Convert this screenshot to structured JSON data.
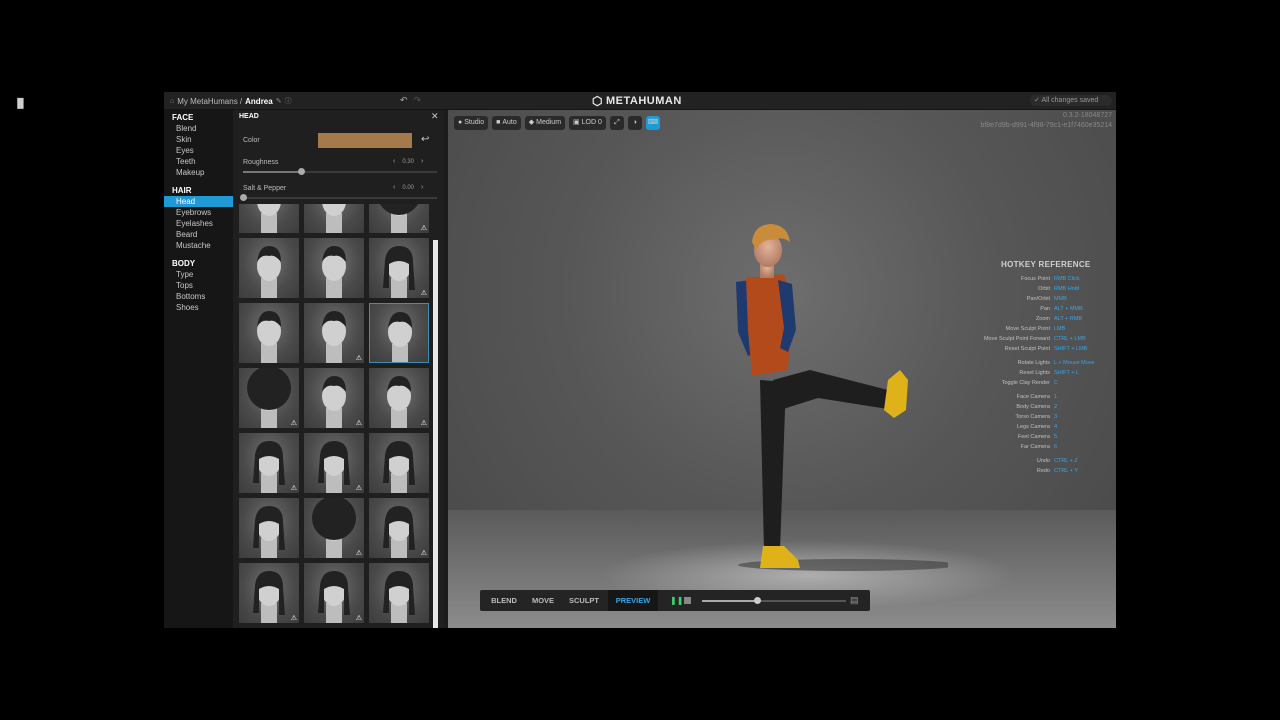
{
  "topbar": {
    "breadcrumb_root": "My MetaHumans /",
    "character_name": "Andrea",
    "logo": "METAHUMAN",
    "save_status": "All changes saved"
  },
  "sidebar": {
    "sections": [
      {
        "title": "FACE",
        "items": [
          "Blend",
          "Skin",
          "Eyes",
          "Teeth",
          "Makeup"
        ]
      },
      {
        "title": "HAIR",
        "items": [
          "Head",
          "Eyebrows",
          "Eyelashes",
          "Beard",
          "Mustache"
        ]
      },
      {
        "title": "BODY",
        "items": [
          "Type",
          "Tops",
          "Bottoms",
          "Shoes"
        ]
      }
    ],
    "active_item": "Head"
  },
  "panel": {
    "title": "HEAD",
    "color_label": "Color",
    "color_value": "#a47a4c",
    "roughness_label": "Roughness",
    "roughness_value": "0.30",
    "roughness_level": 0.3,
    "salt_pepper_label": "Salt & Pepper",
    "salt_pepper_value": "0.00",
    "salt_pepper_level": 0.0,
    "hairstyles": [
      {
        "warn": false
      },
      {
        "warn": false
      },
      {
        "warn": true
      },
      {
        "warn": false
      },
      {
        "warn": false
      },
      {
        "warn": true
      },
      {
        "warn": false
      },
      {
        "warn": true
      },
      {
        "warn": false,
        "selected": true
      },
      {
        "warn": true
      },
      {
        "warn": true
      },
      {
        "warn": true
      },
      {
        "warn": true
      },
      {
        "warn": true
      },
      {
        "warn": false
      },
      {
        "warn": false
      },
      {
        "warn": true
      },
      {
        "warn": true
      },
      {
        "warn": true
      },
      {
        "warn": true
      },
      {
        "warn": false
      }
    ]
  },
  "viewport": {
    "toolbar": {
      "lighting": "Studio",
      "camera": "Auto",
      "quality": "Medium",
      "lod": "LOD 0"
    },
    "version_line1": "0.3.2-18048727",
    "version_line2": "bf8e7d9b-d991-4f98-79c1-e1f7460e35214",
    "hotkeys_title": "HOTKEY REFERENCE",
    "hotkeys": [
      {
        "action": "Focus Point",
        "key": "RMB Click"
      },
      {
        "action": "Orbit",
        "key": "RMB Hold"
      },
      {
        "action": "Pan/Orbit",
        "key": "MMB"
      },
      {
        "action": "Pan",
        "key": "ALT + MMB"
      },
      {
        "action": "Zoom",
        "key": "ALT + RMB"
      },
      {
        "action": "Move Sculpt Point",
        "key": "LMB"
      },
      {
        "action": "Move Sculpt Point Forward",
        "key": "CTRL + LMB"
      },
      {
        "action": "Reset Sculpt Point",
        "key": "SHIFT + LMB"
      },
      {
        "action": "Rotate Lights",
        "key": "L + Mouse Move"
      },
      {
        "action": "Reset Lights",
        "key": "SHIFT + L"
      },
      {
        "action": "Toggle Clay Render",
        "key": "C"
      },
      {
        "action": "Face Camera",
        "key": "1"
      },
      {
        "action": "Body Camera",
        "key": "2"
      },
      {
        "action": "Torso Camera",
        "key": "3"
      },
      {
        "action": "Legs Camera",
        "key": "4"
      },
      {
        "action": "Feet Camera",
        "key": "5"
      },
      {
        "action": "Far Camera",
        "key": "6"
      },
      {
        "action": "Undo",
        "key": "CTRL + Z"
      },
      {
        "action": "Redo",
        "key": "CTRL + Y"
      }
    ],
    "modes": [
      "BLEND",
      "MOVE",
      "SCULPT",
      "PREVIEW"
    ],
    "active_mode": "PREVIEW",
    "timeline_level": 0.38
  },
  "colors": {
    "accent": "#1d9bd7",
    "hotkey_blue": "#3aa5e8",
    "play_green": "#3ccf6e",
    "hair": "#c98c3a",
    "vest": "#b24a1c",
    "sleeves": "#1f3a6e",
    "pants": "#1e1e1e",
    "shoes": "#e0b21a"
  }
}
